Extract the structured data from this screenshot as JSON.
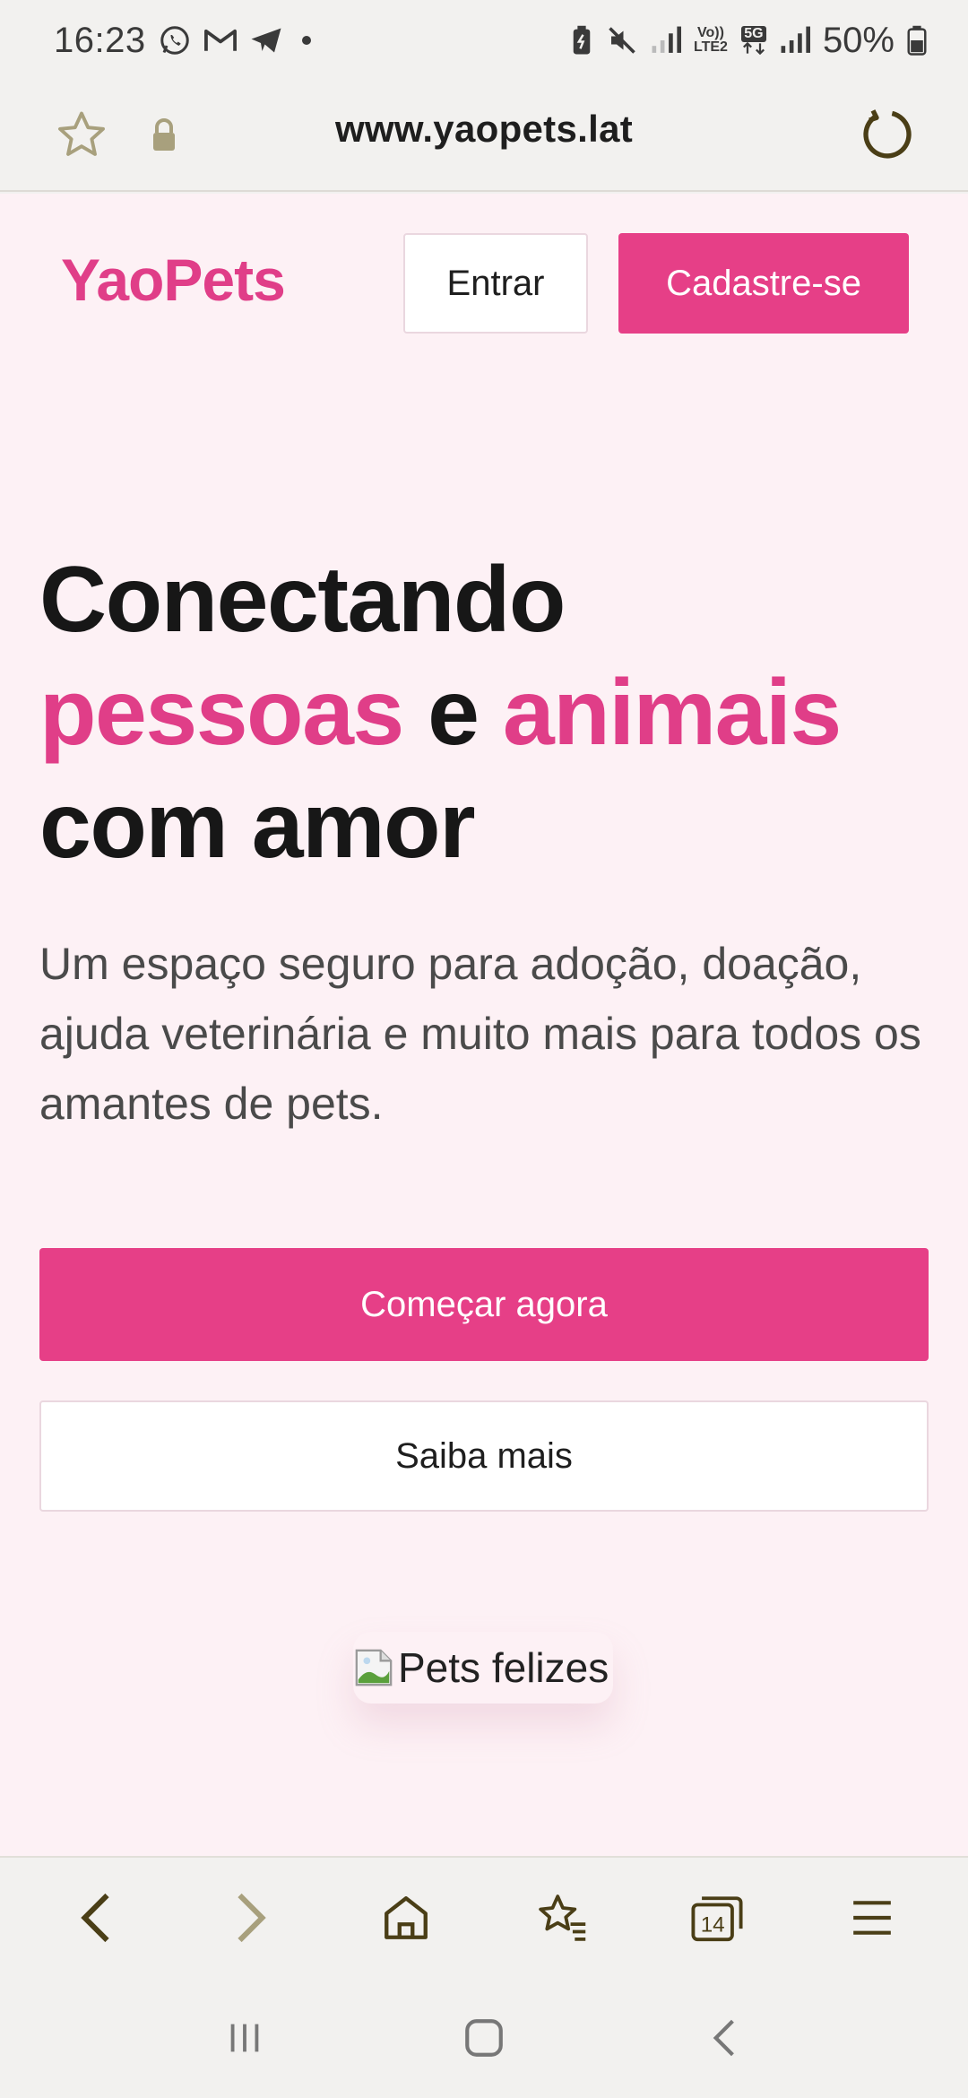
{
  "status_bar": {
    "time": "16:23",
    "network_top": "Vo))",
    "network_bottom": "LTE2",
    "network_5g": "5G",
    "battery": "50%"
  },
  "browser": {
    "url": "www.yaopets.lat"
  },
  "header": {
    "brand": "YaoPets",
    "login_label": "Entrar",
    "signup_label": "Cadastre-se"
  },
  "hero": {
    "title_line1": "Conectando",
    "title_word_pessoas": "pessoas",
    "title_word_e": " e ",
    "title_word_animais": "animais",
    "title_line3": "com amor",
    "subtitle": "Um espaço seguro para adoção, doação, ajuda veterinária e muito mais para todos os amantes de pets.",
    "primary_cta": "Começar agora",
    "secondary_cta": "Saiba mais",
    "image_alt": "Pets felizes"
  },
  "browser_nav": {
    "tabs_count": "14"
  },
  "colors": {
    "brand_pink": "#e63f87",
    "page_background": "#fdf1f5",
    "chrome_background": "#f2f1ef",
    "chrome_icon": "#4a3e16"
  }
}
